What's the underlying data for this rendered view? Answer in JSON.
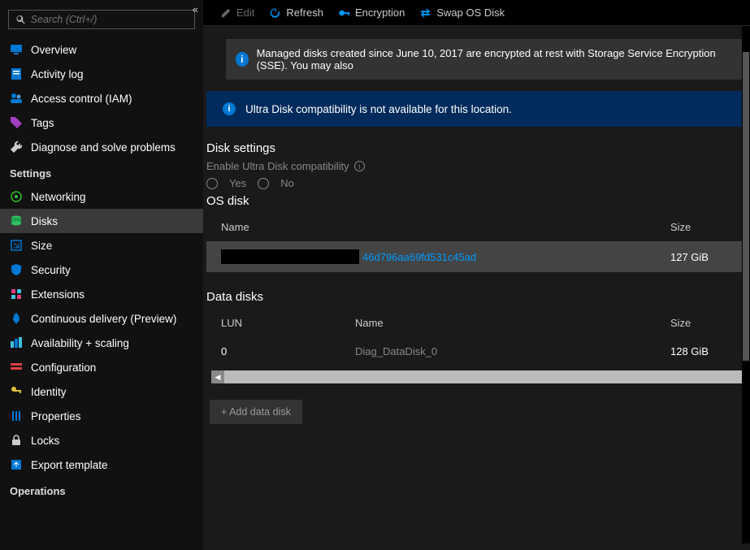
{
  "search": {
    "placeholder": "Search (Ctrl+/)"
  },
  "nav": {
    "overview": "Overview",
    "activityLog": "Activity log",
    "iam": "Access control (IAM)",
    "tags": "Tags",
    "diagnose": "Diagnose and solve problems"
  },
  "sectionSettings": "Settings",
  "settingsNav": {
    "networking": "Networking",
    "disks": "Disks",
    "size": "Size",
    "security": "Security",
    "extensions": "Extensions",
    "cd": "Continuous delivery (Preview)",
    "avail": "Availability + scaling",
    "config": "Configuration",
    "identity": "Identity",
    "properties": "Properties",
    "locks": "Locks",
    "export": "Export template"
  },
  "sectionOperations": "Operations",
  "toolbar": {
    "edit": "Edit",
    "refresh": "Refresh",
    "encryption": "Encryption",
    "swap": "Swap OS Disk"
  },
  "banner1": "Managed disks created since June 10, 2017 are encrypted at rest with Storage Service Encryption (SSE). You may also",
  "banner2": "Ultra Disk compatibility is not available for this location.",
  "diskSettings": {
    "title": "Disk settings",
    "ultraLabel": "Enable Ultra Disk compatibility",
    "yes": "Yes",
    "no": "No"
  },
  "osDisk": {
    "title": "OS disk",
    "colName": "Name",
    "colSize": "Size",
    "linkSuffix": "46d796aa69fd531c45ad",
    "size": "127 GiB"
  },
  "dataDisks": {
    "title": "Data disks",
    "colLun": "LUN",
    "colName": "Name",
    "colSize": "Size",
    "rows": [
      {
        "lun": "0",
        "name": "Diag_DataDisk_0",
        "size": "128 GiB"
      }
    ]
  },
  "addDisk": "+ Add data disk"
}
